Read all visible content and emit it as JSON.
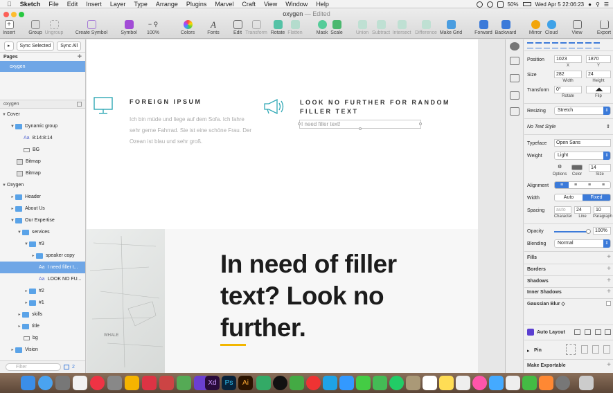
{
  "menubar": {
    "apple": "",
    "app": "Sketch",
    "items": [
      "File",
      "Edit",
      "Insert",
      "Layer",
      "Type",
      "Arrange",
      "Plugins",
      "Marvel",
      "Craft",
      "View",
      "Window",
      "Help"
    ],
    "battery": "50%",
    "datetime": "Wed Apr 5  22:06:23"
  },
  "document": {
    "name": "oxygen",
    "status": "— Edited"
  },
  "toolbar": {
    "insert": "Insert",
    "group": "Group",
    "ungroup": "Ungroup",
    "create_symbol": "Create Symbol",
    "symbol": "Symbol",
    "zoom": "100%",
    "colors": "Colors",
    "fonts": "Fonts",
    "edit": "Edit",
    "transform": "Transform",
    "rotate": "Rotate",
    "flatten": "Flatten",
    "mask": "Mask",
    "scale": "Scale",
    "union": "Union",
    "subtract": "Subtract",
    "intersect": "Intersect",
    "difference": "Difference",
    "make_grid": "Make Grid",
    "forward": "Forward",
    "backward": "Backward",
    "mirror": "Mirror",
    "cloud": "Cloud",
    "view": "View",
    "export": "Export"
  },
  "left_panel": {
    "select_selected": "Sync Selected",
    "sync_all": "Sync All",
    "pages_label": "Pages",
    "current_page": "oxygen",
    "filter_label": "oxygen",
    "filter_placeholder": "Filter",
    "layers": [
      {
        "label": "Cover",
        "type": "page-group"
      },
      {
        "label": "Dynamic group",
        "type": "folder"
      },
      {
        "label": "8:14:8:14",
        "type": "text"
      },
      {
        "label": "BG",
        "type": "rect"
      },
      {
        "label": "Bitmap",
        "type": "bitmap"
      },
      {
        "label": "Bitmap",
        "type": "bitmap"
      },
      {
        "label": "Oxygen",
        "type": "page-group"
      },
      {
        "label": "Header",
        "type": "folder"
      },
      {
        "label": "About Us",
        "type": "folder"
      },
      {
        "label": "Our Expertise",
        "type": "folder"
      },
      {
        "label": "services",
        "type": "folder"
      },
      {
        "label": "#3",
        "type": "folder"
      },
      {
        "label": "speaker copy",
        "type": "folder"
      },
      {
        "label": "I need filler t...",
        "type": "text",
        "selected": true
      },
      {
        "label": "LOOK NO FU...",
        "type": "text"
      },
      {
        "label": "#2",
        "type": "folder"
      },
      {
        "label": "#1",
        "type": "folder"
      },
      {
        "label": "skills",
        "type": "folder"
      },
      {
        "label": "title",
        "type": "folder"
      },
      {
        "label": "bg",
        "type": "rect"
      },
      {
        "label": "Vision",
        "type": "folder"
      }
    ],
    "bottom_count": "2"
  },
  "canvas": {
    "feature1_title": "FOREIGN IPSUM",
    "feature1_body": "Ich bin müde und liege auf dem Sofa. Ich fahre sehr gerne Fahrrad. Sie ist eine schöne Frau. Der Ozean ist blau und sehr groß.",
    "feature2_title": "LOOK NO FURTHER FOR RANDOM FILLER TEXT",
    "feature2_body": "I need filler text!",
    "sketch_caption": "WHALE",
    "headline": "In need of filler text? Look no further."
  },
  "inspector": {
    "position_label": "Position",
    "pos_x": "1023",
    "pos_y": "1870",
    "x_label": "X",
    "y_label": "Y",
    "size_label": "Size",
    "width": "282",
    "height": "24",
    "width_label": "Width",
    "height_label": "Height",
    "transform_label": "Transform",
    "rotate_value": "0°",
    "rotate_label": "Rotate",
    "flip_label": "Flip",
    "resizing_label": "Resizing",
    "resizing_value": "Stretch",
    "text_style": "No Text Style",
    "typeface_label": "Typeface",
    "typeface": "Open Sans",
    "weight_label": "Weight",
    "weight": "Light",
    "options_label": "Options",
    "color_label": "Color",
    "font_size": "14",
    "size_sub": "Size",
    "alignment_label": "Alignment",
    "width_mode_label": "Width",
    "width_auto": "Auto",
    "width_fixed": "Fixed",
    "spacing_label": "Spacing",
    "char_spacing": "auto",
    "line_spacing": "24",
    "para_spacing": "10",
    "character_label": "Character",
    "line_label": "Line",
    "paragraph_label": "Paragraph",
    "opacity_label": "Opacity",
    "opacity": "100%",
    "opacity_fraction": 1.0,
    "blending_label": "Blending",
    "blending": "Normal",
    "fills": "Fills",
    "borders": "Borders",
    "shadows": "Shadows",
    "inner_shadows": "Inner Shadows",
    "gaussian_blur": "Gaussian Blur ◇",
    "auto_layout": "Auto Layout",
    "pin": "Pin",
    "make_exportable": "Make Exportable"
  },
  "colors": {
    "accent": "#3b7ad9",
    "selection": "#6fa6e6",
    "brand_underline": "#f2b600",
    "teal_icon": "#2fa8b5"
  }
}
